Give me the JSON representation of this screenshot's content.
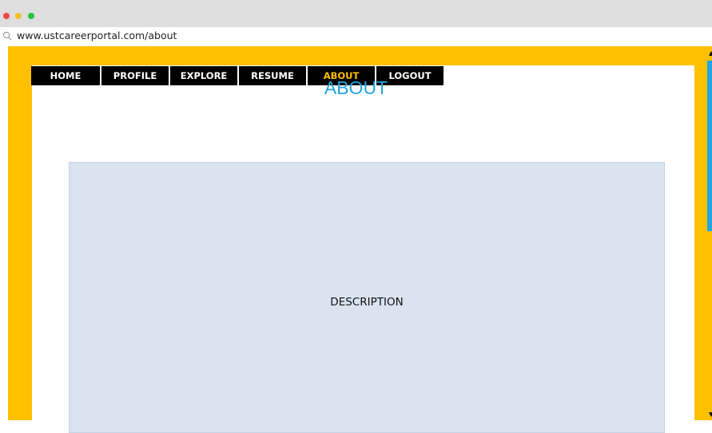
{
  "browser": {
    "url": "www.ustcareerportal.com/about",
    "window_controls": [
      "close",
      "minimize",
      "maximize"
    ]
  },
  "nav": {
    "items": [
      {
        "label": "HOME",
        "active": false
      },
      {
        "label": "PROFILE",
        "active": false
      },
      {
        "label": "EXPLORE",
        "active": false
      },
      {
        "label": "RESUME",
        "active": false
      },
      {
        "label": "ABOUT",
        "active": true
      },
      {
        "label": "LOGOUT",
        "active": false
      }
    ]
  },
  "page": {
    "title": "ABOUT",
    "description": "DESCRIPTION"
  },
  "colors": {
    "frame": "#ffc000",
    "nav_background": "#000000",
    "nav_text": "#ffffff",
    "nav_active_text": "#ffc000",
    "title": "#22a5e0",
    "description_box": "#dae3ef"
  }
}
